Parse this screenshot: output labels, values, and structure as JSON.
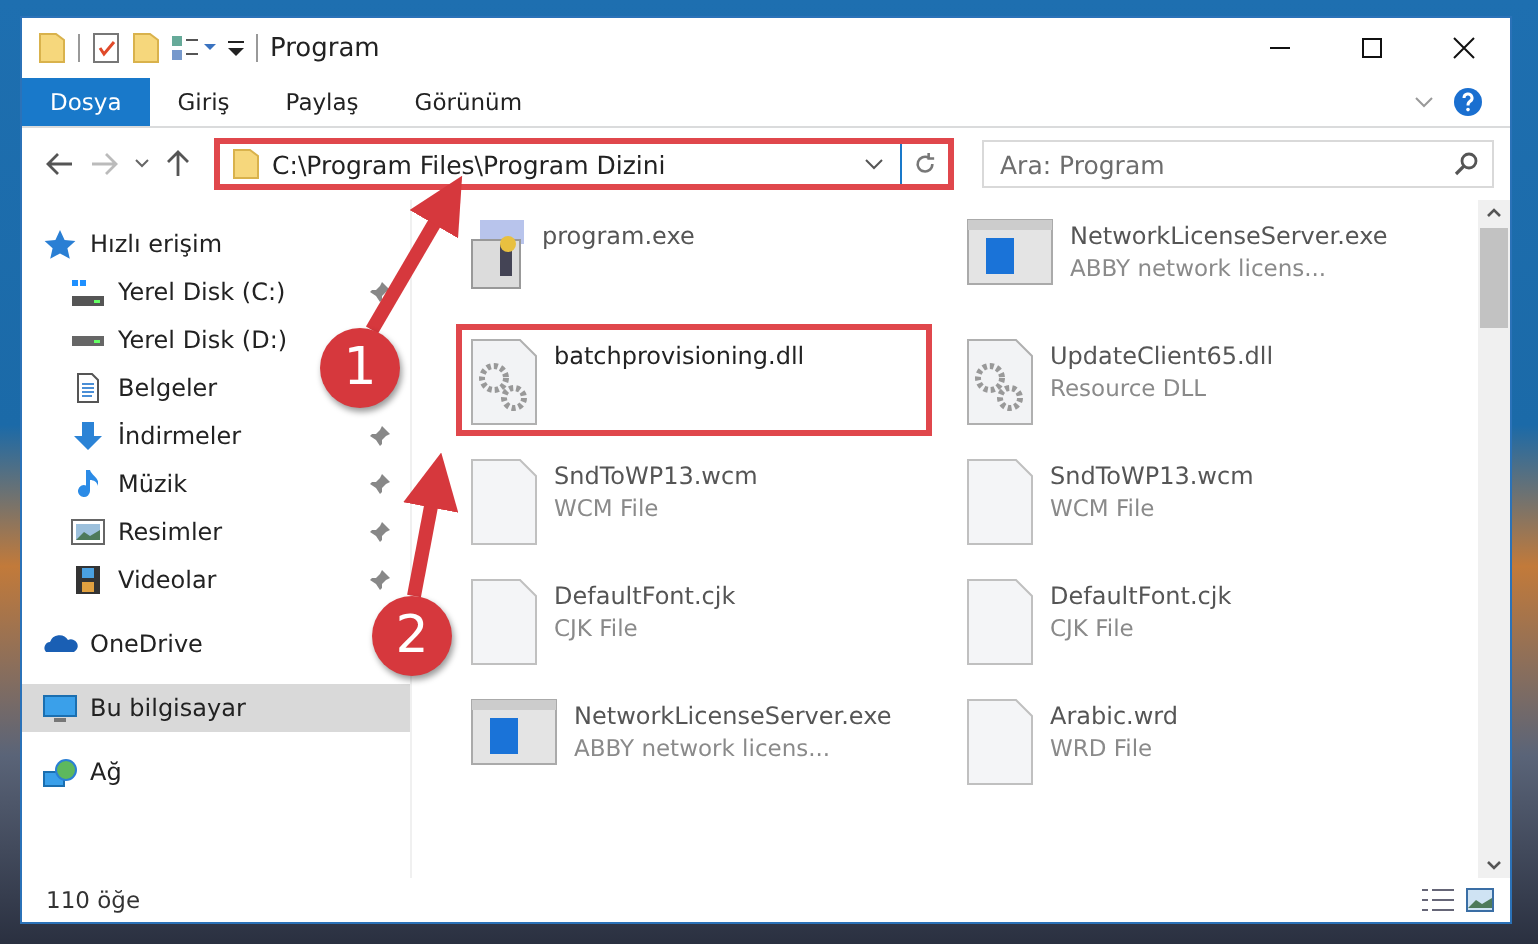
{
  "window": {
    "title": "Program"
  },
  "ribbon_tabs": [
    {
      "label": "Dosya",
      "selected": true
    },
    {
      "label": "Giriş",
      "selected": false
    },
    {
      "label": "Paylaş",
      "selected": false
    },
    {
      "label": "Görünüm",
      "selected": false
    }
  ],
  "address_bar": {
    "path": "C:\\Program Files\\Program Dizini",
    "annotated": true
  },
  "search": {
    "placeholder": "Ara: Program"
  },
  "sidebar": {
    "items": [
      {
        "label": "Hızlı erişim",
        "selected": false,
        "children": [
          {
            "label": "Yerel Disk (C:)",
            "pinned": true
          },
          {
            "label": "Yerel Disk (D:)",
            "pinned": false
          },
          {
            "label": "Belgeler",
            "pinned": false
          },
          {
            "label": "İndirmeler",
            "pinned": true
          },
          {
            "label": "Müzik",
            "pinned": true
          },
          {
            "label": "Resimler",
            "pinned": true
          },
          {
            "label": "Videolar",
            "pinned": true
          }
        ]
      },
      {
        "label": "OneDrive",
        "selected": false
      },
      {
        "label": "Bu bilgisayar",
        "selected": true
      },
      {
        "label": "Ağ",
        "selected": false
      }
    ]
  },
  "files": [
    {
      "name": "program.exe",
      "kind": "installer",
      "annotated": false
    },
    {
      "name": "NetworkLicenseServer.exe",
      "type": "ABBY network licens...",
      "kind": "window",
      "annotated": false
    },
    {
      "name": "batchprovisioning.dll",
      "kind": "gears",
      "annotated": true
    },
    {
      "name": "UpdateClient65.dll",
      "type": "Resource DLL",
      "kind": "gears",
      "annotated": false
    },
    {
      "name": "SndToWP13.wcm",
      "type": "WCM File",
      "kind": "blank",
      "annotated": false
    },
    {
      "name": "SndToWP13.wcm",
      "type": "WCM File",
      "kind": "blank",
      "annotated": false
    },
    {
      "name": "DefaultFont.cjk",
      "type": "CJK File",
      "kind": "blank",
      "annotated": false
    },
    {
      "name": "DefaultFont.cjk",
      "type": "CJK File",
      "kind": "blank",
      "annotated": false
    },
    {
      "name": "NetworkLicenseServer.exe",
      "type": "ABBY network licens...",
      "kind": "window",
      "annotated": false
    },
    {
      "name": "Arabic.wrd",
      "type": "WRD File",
      "kind": "blank",
      "annotated": false
    }
  ],
  "status_bar": {
    "item_count": "110 öğe"
  },
  "annotations": [
    {
      "number": "1"
    },
    {
      "number": "2"
    }
  ]
}
